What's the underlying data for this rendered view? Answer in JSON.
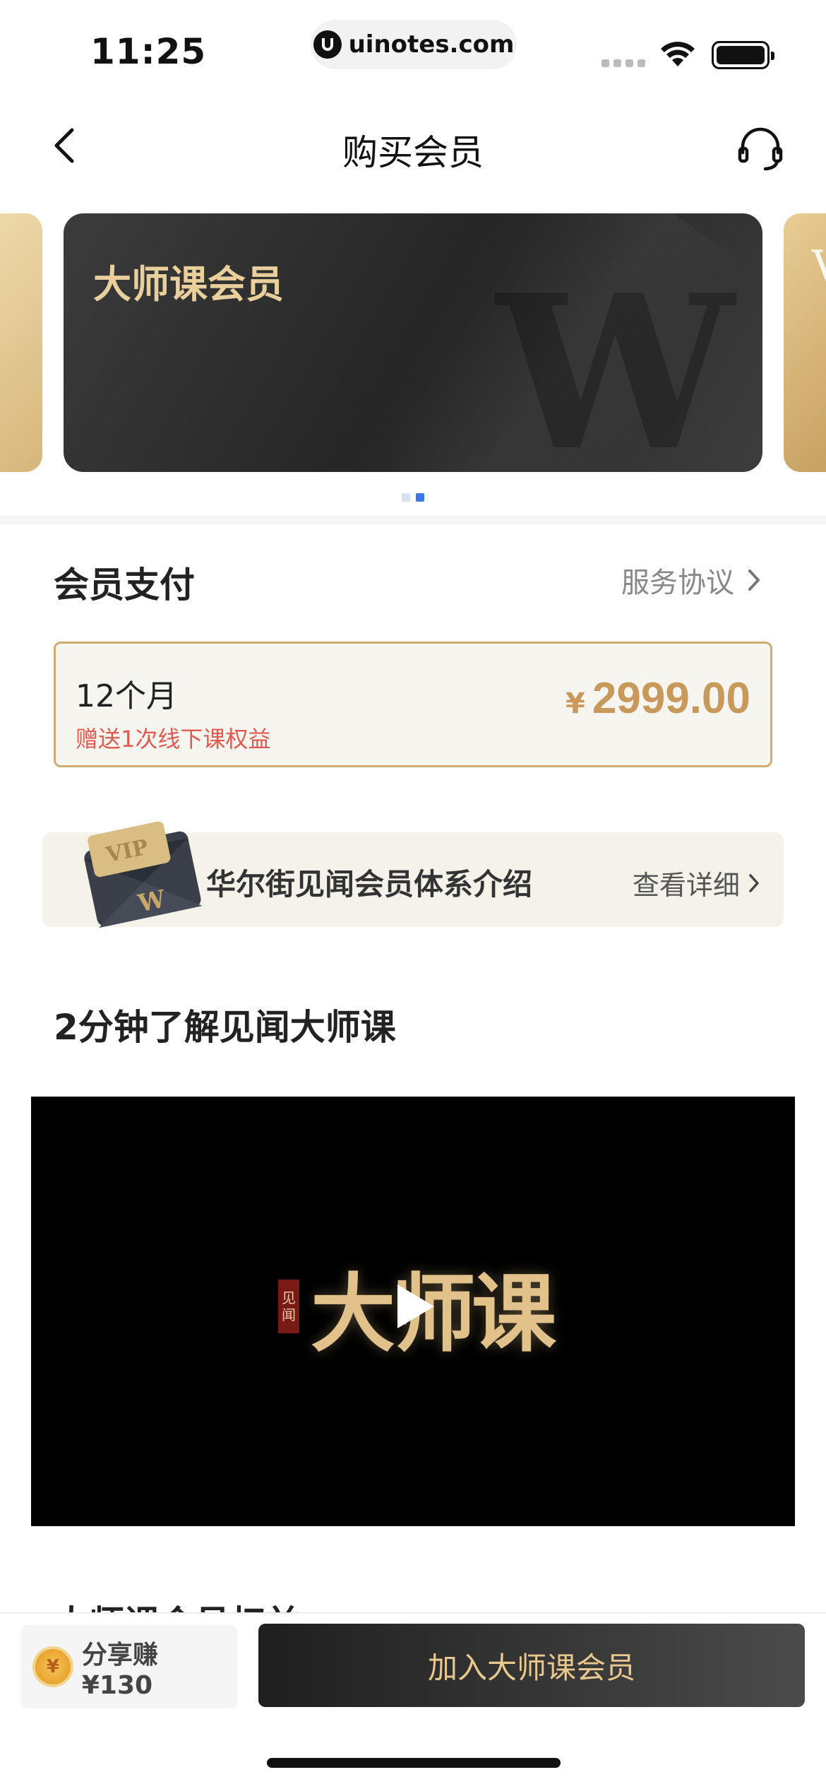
{
  "status": {
    "time": "11:25",
    "url": "uinotes.com"
  },
  "nav": {
    "title": "购买会员"
  },
  "carousel": {
    "main_card_title": "大师课会员",
    "right_card_peek": "V",
    "page_count": 2,
    "active_index": 1
  },
  "payment": {
    "section_title": "会员支付",
    "agreement_label": "服务协议",
    "plan": {
      "duration": "12个月",
      "gift": "赠送1次线下课权益",
      "currency": "¥",
      "price": "2999.00"
    }
  },
  "intro": {
    "vip_badge": "VIP",
    "text": "华尔街见闻会员体系介绍",
    "link": "查看详细"
  },
  "video": {
    "section_title": "2分钟了解见闻大师课",
    "seal_text": "见闻",
    "brand_text": "大师课"
  },
  "next_section_title": "大师课会员权益",
  "bottom": {
    "share_coin": "¥",
    "share_label": "分享赚 ¥130",
    "join_label": "加入大师课会员"
  },
  "colors": {
    "gold": "#c9995b",
    "accent_red": "#e05a4f",
    "dot_active": "#3b78e7"
  }
}
